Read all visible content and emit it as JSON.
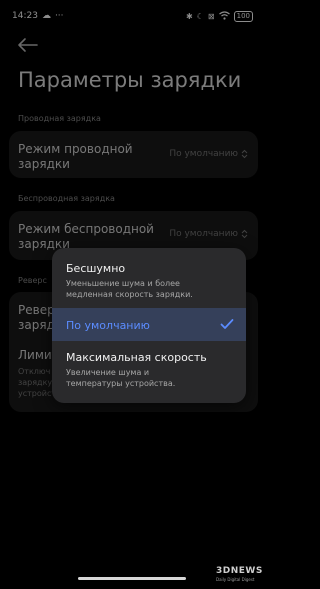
{
  "status_bar": {
    "time": "14:23",
    "dots": "···",
    "battery": "100"
  },
  "page_title": "Параметры зарядки",
  "sections": {
    "wired": {
      "label": "Проводная зарядка",
      "row_label": "Режим проводной\nзарядки",
      "row_value": "По умолчанию"
    },
    "wireless": {
      "label": "Беспроводная зарядка",
      "row_label": "Режим беспроводной\nзарядки",
      "row_value": "По умолчанию"
    },
    "reverse": {
      "label": "Реверс",
      "row1_label": "Ревер\nзаряд",
      "row2_label": "Лимит",
      "row2_sub": "Отключ\nзарядку\nустройств"
    }
  },
  "popup": {
    "options": [
      {
        "title": "Бесшумно",
        "subtitle": "Уменьшение шума и более\nмедленная скорость зарядки."
      },
      {
        "title": "По умолчанию",
        "subtitle": "",
        "selected": true
      },
      {
        "title": "Максимальная скорость",
        "subtitle": "Увеличение шума и\nтемпературы устройства."
      }
    ]
  },
  "watermark": {
    "logo": "3DNEWS",
    "sub": "Daily Digital Digest"
  },
  "colors": {
    "accent": "#5b8cff",
    "selected_bg": "#35405a",
    "popup_bg": "#2a2a2c",
    "card_bg": "#1a1a1a"
  }
}
